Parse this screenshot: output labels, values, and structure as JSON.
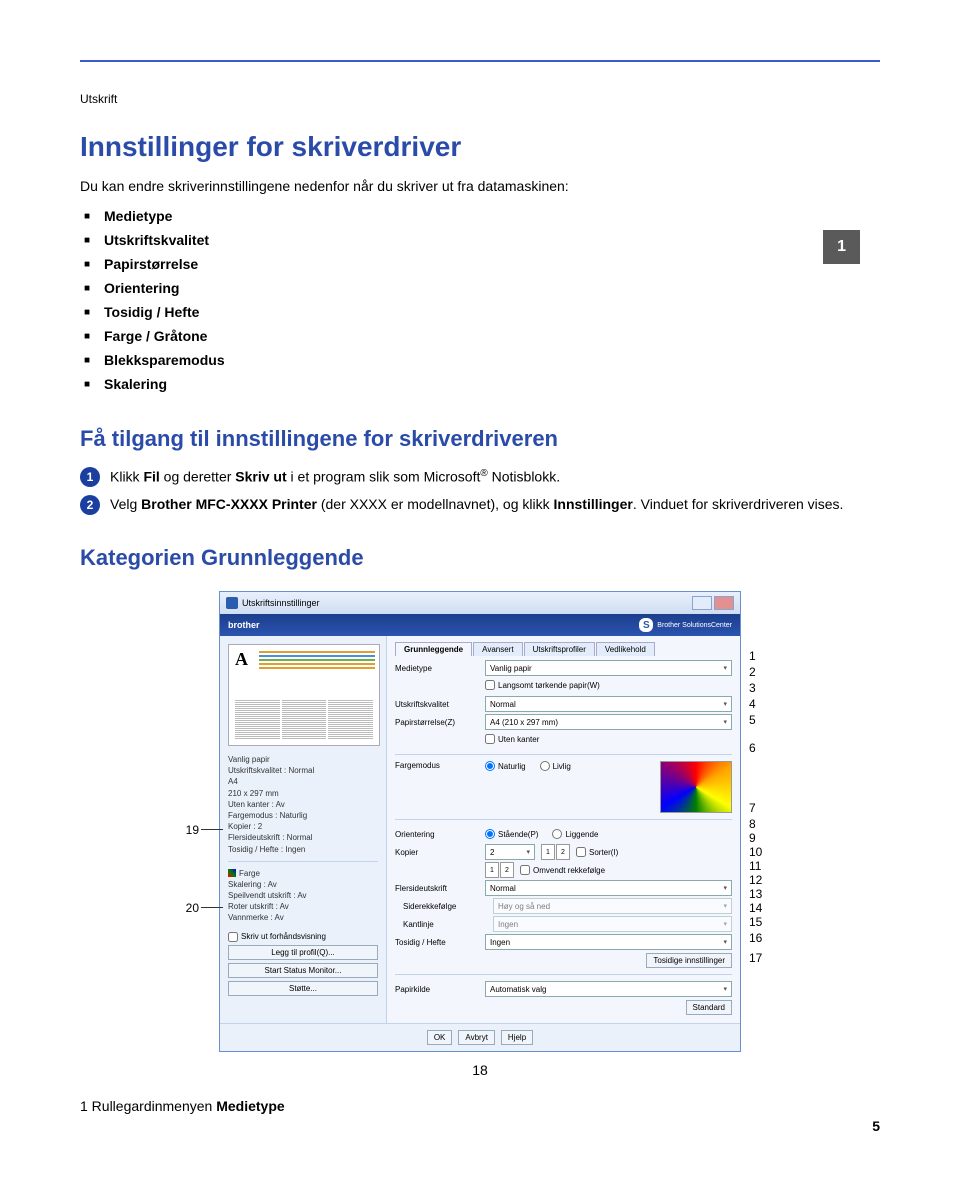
{
  "section": "Utskrift",
  "side_tab": "1",
  "h1": "Innstillinger for skriverdriver",
  "intro": "Du kan endre skriverinnstillingene nedenfor når du skriver ut fra datamaskinen:",
  "bullets": [
    "Medietype",
    "Utskriftskvalitet",
    "Papirstørrelse",
    "Orientering",
    "Tosidig / Hefte",
    "Farge / Gråtone",
    "Blekksparemodus",
    "Skalering"
  ],
  "h2a": "Få tilgang til innstillingene for skriverdriveren",
  "steps": {
    "s1_pre": "Klikk ",
    "s1_b1": "Fil",
    "s1_mid": " og deretter ",
    "s1_b2": "Skriv ut",
    "s1_post": " i et program slik som Microsoft",
    "s1_sup": "®",
    "s1_end": " Notisblokk.",
    "s2_pre": "Velg ",
    "s2_b1": "Brother MFC-XXXX Printer",
    "s2_mid": " (der XXXX er modellnavnet), og klikk ",
    "s2_b2": "Innstillinger",
    "s2_post": ". Vinduet for skriverdriveren vises."
  },
  "h2b": "Kategorien Grunnleggende",
  "dialog": {
    "title": "Utskriftsinnstillinger",
    "brand": "brother",
    "solutions": "Brother SolutionsCenter",
    "tabs": [
      "Grunnleggende",
      "Avansert",
      "Utskriftsprofiler",
      "Vedlikehold"
    ],
    "left": {
      "a": "A",
      "specs": [
        "Vanlig papir",
        "Utskriftskvalitet : Normal",
        "A4",
        "210 x 297 mm",
        "Uten kanter : Av",
        "Fargemodus : Naturlig",
        "Kopier : 2",
        "Flersideutskrift : Normal",
        "Tosidig / Hefte : Ingen"
      ],
      "specs2": [
        "Farge",
        "Skalering : Av",
        "Speilvendt utskrift : Av",
        "Roter utskrift : Av",
        "Vannmerke : Av"
      ],
      "left_btns": [
        "Skriv ut forhåndsvisning",
        "Legg til profil(Q)...",
        "Start Status Monitor...",
        "Støtte..."
      ]
    },
    "rows": {
      "medietype": {
        "lbl": "Medietype",
        "val": "Vanlig papir"
      },
      "langsomt": "Langsomt tørkende papir(W)",
      "kvalitet": {
        "lbl": "Utskriftskvalitet",
        "val": "Normal"
      },
      "storrelse": {
        "lbl": "Papirstørrelse(Z)",
        "val": "A4 (210 x 297 mm)"
      },
      "uten_kanter": "Uten kanter",
      "fargemodus": {
        "lbl": "Fargemodus",
        "opt1": "Naturlig",
        "opt2": "Livlig"
      },
      "orientering": {
        "lbl": "Orientering",
        "opt1": "Stående(P)",
        "opt2": "Liggende"
      },
      "kopier": {
        "lbl": "Kopier",
        "val": "2",
        "sort": "Sorter(I)",
        "omv": "Omvendt rekkefølge"
      },
      "flerside": {
        "lbl": "Flersideutskrift",
        "val": "Normal"
      },
      "siderek": {
        "lbl": "Siderekkefølge",
        "val": "Høy og så ned"
      },
      "kantlinje": {
        "lbl": "Kantlinje",
        "val": "Ingen"
      },
      "tosidig": {
        "lbl": "Tosidig / Hefte",
        "val": "Ingen"
      },
      "tosidig_btn": "Tosidige innstillinger",
      "papirkilde": {
        "lbl": "Papirkilde",
        "val": "Automatisk valg"
      },
      "standard_btn": "Standard"
    },
    "bottom": [
      "OK",
      "Avbryt",
      "Hjelp"
    ]
  },
  "callouts": {
    "left": {
      "c19": "19",
      "c20": "20"
    },
    "right": [
      "1",
      "2",
      "3",
      "4",
      "5",
      "6",
      "7",
      "8",
      "9",
      "10",
      "11",
      "12",
      "13",
      "14",
      "15",
      "16",
      "17"
    ],
    "bottom": "18"
  },
  "footer_item": "1  Rullegardinmenyen ",
  "footer_bold": "Medietype",
  "page_number": "5"
}
